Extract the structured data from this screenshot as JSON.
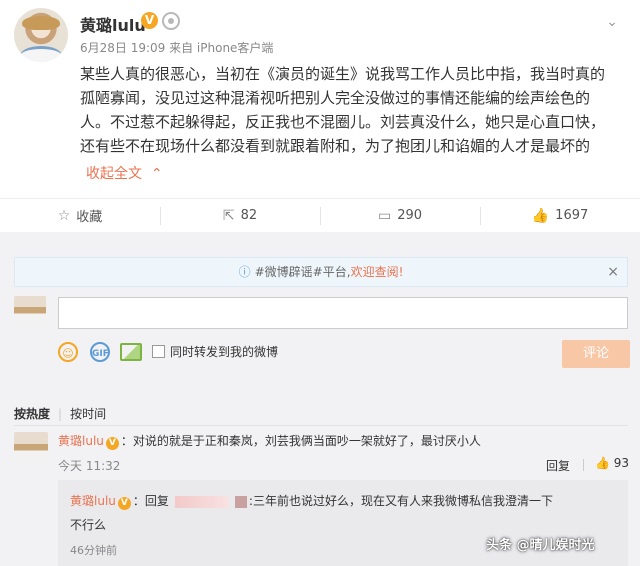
{
  "post": {
    "username": "黄璐lulu",
    "verified_badge": "V",
    "meta": "6月28日 19:09 来自 iPhone客户端",
    "lines": [
      "某些人真的很恶心，当初在《演员的诞生》说我骂工作人员比中指，我当时真的",
      "孤陋寡闻，没见过这种混淆视听把别人完全没做过的事情还能编的绘声绘色的",
      "人。不过惹不起躲得起，反正我也不混圈儿。刘芸真没什么，她只是心直口快，",
      "还有些不在现场什么都没看到就跟着附和，为了抱团儿和谄媚的人才是最坏的"
    ],
    "collapse_label": "收起全文",
    "collapse_icon": "chevron-up"
  },
  "actions": {
    "favorite": {
      "label": "收藏",
      "icon": "star"
    },
    "repost": {
      "count": "82",
      "icon": "share"
    },
    "comment": {
      "count": "290",
      "icon": "comment"
    },
    "like": {
      "count": "1697",
      "icon": "thumb-up"
    }
  },
  "notice": {
    "prefix": "#微博辟谣#平台,",
    "link": "欢迎查阅!",
    "close": "×"
  },
  "composer": {
    "gif_label": "GIF",
    "also_repost_label": "同时转发到我的微博",
    "submit_label": "评论"
  },
  "sort": {
    "hot": "按热度",
    "time": "按时间"
  },
  "comment": {
    "username": "黄璐lulu",
    "badge": "V",
    "text": "：对说的就是于正和秦岚，刘芸我俩当面吵一架就好了，最讨厌小人",
    "time": "今天 11:32",
    "reply_label": "回复",
    "likes": "93",
    "sub_reply": {
      "username": "黄璐lulu",
      "badge": "V",
      "prefix": "：回复",
      "text": ":三年前也说过好么，现在又有人来我微博私信我澄清一下",
      "text_line2": "不行么",
      "time": "46分钟前"
    }
  },
  "watermark": "头条 @晴儿娱时光",
  "colors": {
    "accent": "#eb7350",
    "badge": "#f5a623",
    "submit_disabled": "#f7c7a6",
    "link_blue": "#5b9bd5"
  }
}
